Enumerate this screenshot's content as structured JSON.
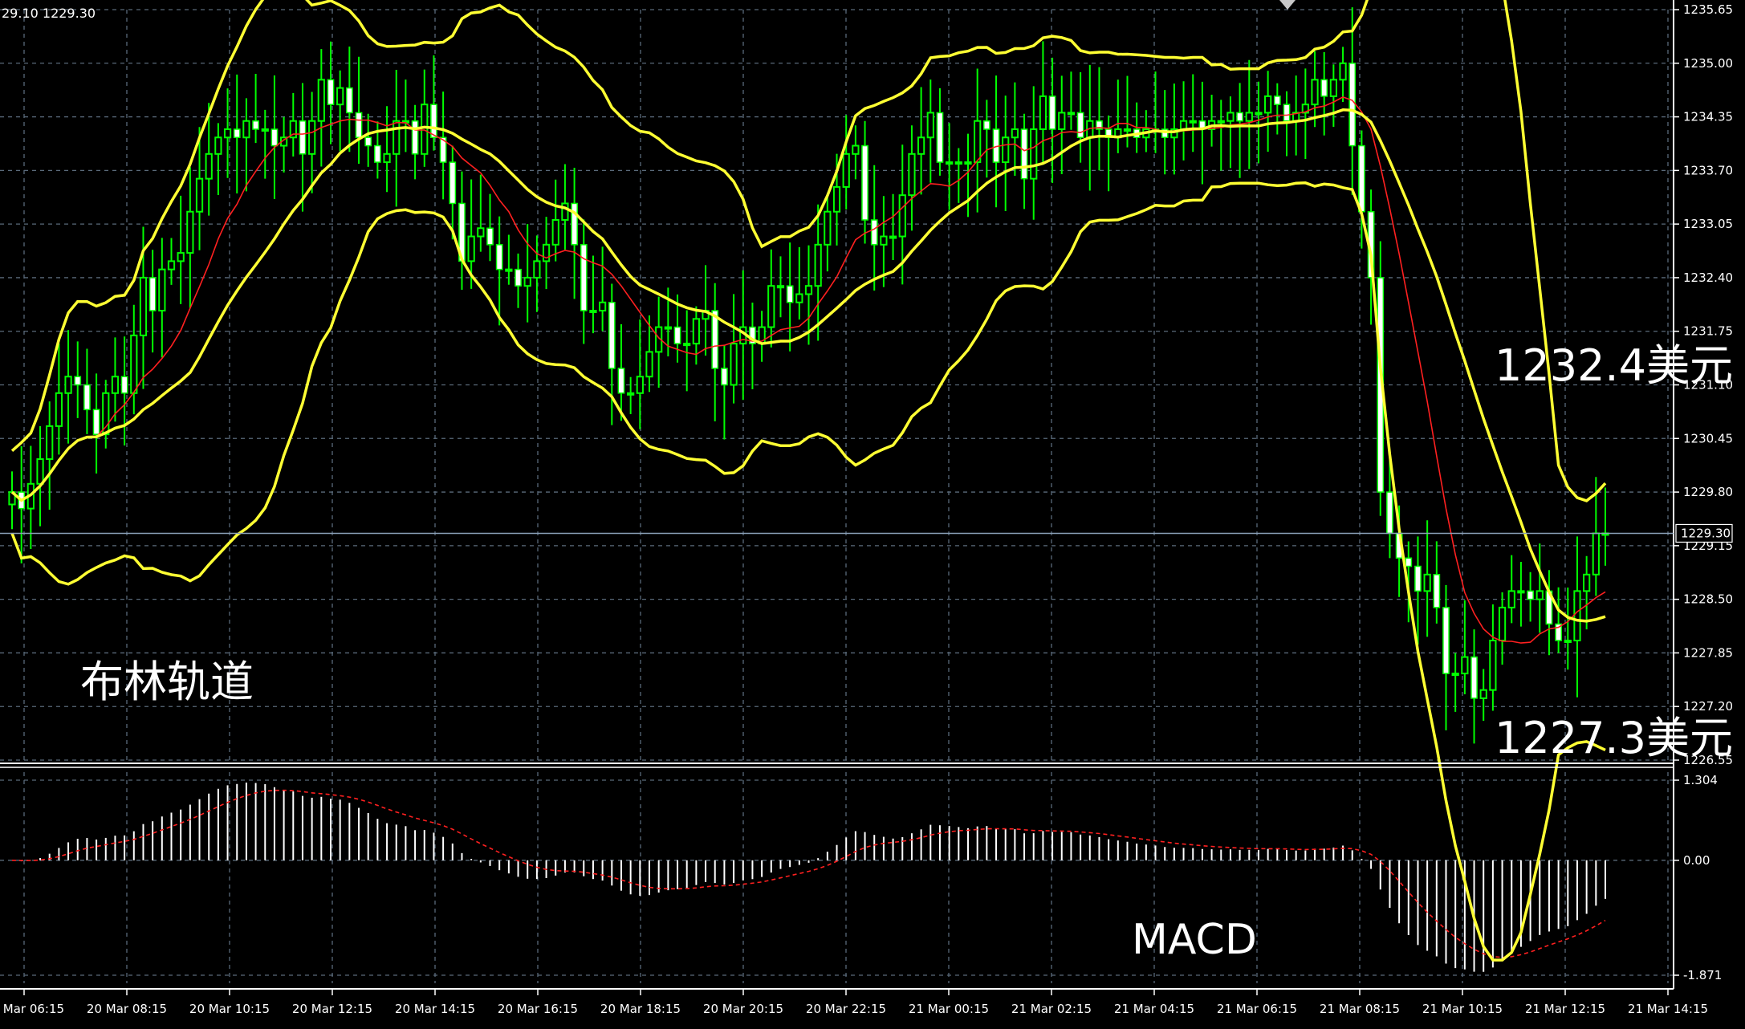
{
  "header": {
    "info_text": "29.10 1229.30"
  },
  "annotations": {
    "bollinger_label": "布林轨道",
    "macd_label": "MACD",
    "upper_price_label": "1232.4美元",
    "lower_price_label": "1227.3美元"
  },
  "current_price": {
    "value": 1229.3,
    "label": "1229.30"
  },
  "chart_data": [
    {
      "type": "candlestick",
      "title": "",
      "indicator": "Bollinger Bands",
      "ylim": [
        1226.55,
        1235.65
      ],
      "y_ticks": [
        "1235.65",
        "1235.00",
        "1234.35",
        "1233.70",
        "1233.05",
        "1232.40",
        "1231.75",
        "1231.10",
        "1230.45",
        "1229.80",
        "1229.15",
        "1228.50",
        "1227.85",
        "1227.20",
        "1226.55"
      ],
      "x_ticks": [
        "20 Mar 06:15",
        "20 Mar 08:15",
        "20 Mar 10:15",
        "20 Mar 12:15",
        "20 Mar 14:15",
        "20 Mar 16:15",
        "20 Mar 18:15",
        "20 Mar 20:15",
        "20 Mar 22:15",
        "21 Mar 00:15",
        "21 Mar 02:15",
        "21 Mar 04:15",
        "21 Mar 06:15",
        "21 Mar 08:15",
        "21 Mar 10:15",
        "21 Mar 12:15",
        "21 Mar 14:15"
      ],
      "grid": true,
      "colors": {
        "bull": "#00ff00",
        "bear_body": "#ffffff",
        "bands": "#ffff33",
        "moving_average": "#ff2020",
        "grid": "#5a6a7a",
        "price_line": "#8aa0b8"
      },
      "close_series": [
        1229.8,
        1229.6,
        1229.9,
        1230.2,
        1230.6,
        1231.0,
        1231.2,
        1231.1,
        1230.8,
        1230.5,
        1231.0,
        1231.2,
        1231.0,
        1231.7,
        1232.4,
        1232.0,
        1232.5,
        1232.6,
        1232.7,
        1233.2,
        1233.6,
        1233.9,
        1234.1,
        1234.2,
        1234.1,
        1234.3,
        1234.2,
        1234.2,
        1234.0,
        1234.1,
        1234.3,
        1233.9,
        1234.3,
        1234.8,
        1234.5,
        1234.7,
        1234.4,
        1234.1,
        1234.0,
        1233.8,
        1233.9,
        1234.3,
        1234.3,
        1233.9,
        1234.5,
        1234.1,
        1233.8,
        1233.3,
        1232.6,
        1232.9,
        1233.0,
        1232.8,
        1232.5,
        1232.5,
        1232.3,
        1232.4,
        1232.6,
        1232.8,
        1233.1,
        1233.3,
        1232.8,
        1232.0,
        1232.0,
        1232.1,
        1231.3,
        1231.0,
        1231.0,
        1231.2,
        1231.5,
        1231.8,
        1231.8,
        1231.6,
        1231.6,
        1231.9,
        1232.0,
        1231.3,
        1231.1,
        1231.6,
        1231.8,
        1231.6,
        1231.8,
        1232.3,
        1232.3,
        1232.1,
        1232.2,
        1232.3,
        1232.8,
        1233.2,
        1233.5,
        1233.9,
        1234.0,
        1233.1,
        1232.8,
        1232.9,
        1232.9,
        1233.4,
        1233.9,
        1234.1,
        1234.4,
        1233.8,
        1233.8,
        1233.8,
        1233.8,
        1234.3,
        1234.2,
        1233.8,
        1234.1,
        1234.2,
        1233.6,
        1234.2,
        1234.6,
        1234.2,
        1234.4,
        1234.4,
        1234.1,
        1234.3,
        1234.2,
        1234.1,
        1234.2,
        1234.2,
        1234.1,
        1234.2,
        1234.2,
        1234.1,
        1234.2,
        1234.3,
        1234.3,
        1234.2,
        1234.3,
        1234.3,
        1234.4,
        1234.3,
        1234.4,
        1234.4,
        1234.6,
        1234.5,
        1234.3,
        1234.4,
        1234.5,
        1234.8,
        1234.6,
        1234.8,
        1235.0,
        1234.0,
        1233.2,
        1232.4,
        1229.8,
        1229.3,
        1229.0,
        1228.9,
        1228.6,
        1228.8,
        1228.4,
        1227.6,
        1227.6,
        1227.8,
        1227.3,
        1227.4,
        1228.0,
        1228.4,
        1228.6,
        1228.6,
        1228.5,
        1228.6,
        1228.2,
        1228.0,
        1228.0,
        1228.6,
        1228.8,
        1229.3,
        1229.3
      ],
      "annotations": [
        "布林轨道",
        "1232.4美元",
        "1227.3美元"
      ]
    },
    {
      "type": "bar",
      "title": "",
      "indicator": "MACD",
      "ylim": [
        -1.871,
        1.304
      ],
      "y_ticks": [
        "1.304",
        "0.00",
        "-1.871"
      ],
      "zero_line": 0.0,
      "colors": {
        "histogram": "#ffffff",
        "signal": "#ff2020"
      },
      "annotations": [
        "MACD"
      ]
    }
  ]
}
